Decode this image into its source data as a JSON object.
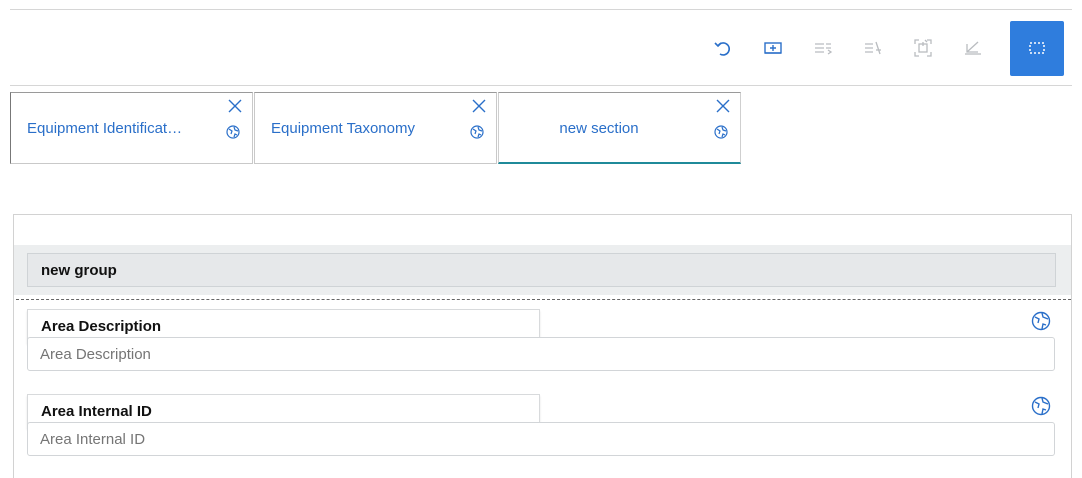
{
  "toolbar": {
    "buttons": [
      {
        "name": "undo",
        "icon": "undo-icon",
        "state": "enabled"
      },
      {
        "name": "add-section",
        "icon": "add-section-icon",
        "state": "enabled"
      },
      {
        "name": "add-group",
        "icon": "add-group-icon",
        "state": "disabled"
      },
      {
        "name": "add-field",
        "icon": "add-field-icon",
        "state": "disabled"
      },
      {
        "name": "fit-view",
        "icon": "fit-view-icon",
        "state": "disabled"
      },
      {
        "name": "remove-formatting",
        "icon": "edit-disabled-icon",
        "state": "disabled"
      },
      {
        "name": "select-mode",
        "icon": "selection-icon",
        "state": "active"
      }
    ],
    "accent_color": "#2f7ddd",
    "enabled_icon_color": "#2a6fc9",
    "disabled_icon_color": "#b9bcc0"
  },
  "tabs": [
    {
      "label": "Equipment Identificat…",
      "active": false
    },
    {
      "label": "Equipment Taxonomy",
      "active": false
    },
    {
      "label": "new section",
      "active": true
    }
  ],
  "section": {
    "group": {
      "title": "new group"
    },
    "fields": [
      {
        "label": "Area Description",
        "placeholder": "Area Description"
      },
      {
        "label": "Area Internal ID",
        "placeholder": "Area Internal ID"
      }
    ]
  },
  "colors": {
    "active_tab_underline": "#1f8a99",
    "link_text": "#2a6fc9"
  }
}
